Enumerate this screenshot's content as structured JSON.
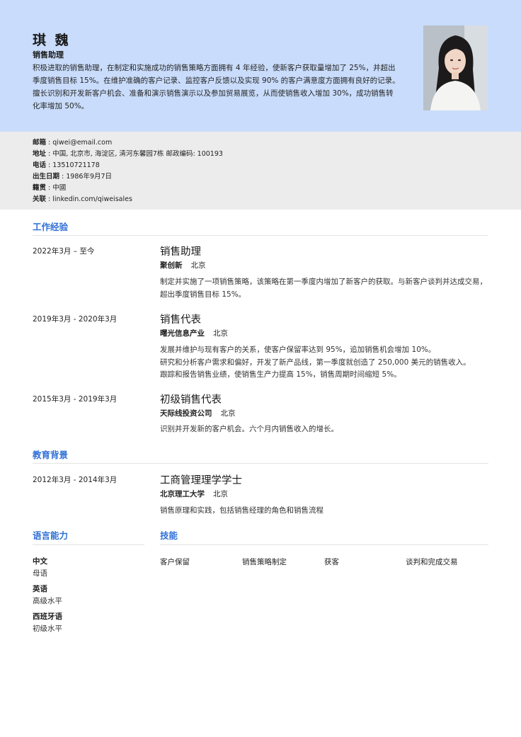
{
  "header": {
    "name": "琪 魏",
    "title": "销售助理",
    "summary": "积极进取的销售助理，在制定和实施成功的销售策略方面拥有 4 年经验，使新客户获取量增加了 25%，并超出季度销售目标 15%。在维护准确的客户记录、监控客户反馈以及实现 90% 的客户满意度方面拥有良好的记录。擅长识别和开发新客户机会、准备和演示销售演示以及参加贸易展览，从而使销售收入增加 30%，成功销售转化率增加 50%。"
  },
  "contact": [
    {
      "label": "邮箱",
      "value": "qiwei@email.com"
    },
    {
      "label": "地址",
      "value": "中国, 北京市, 海淀区, 清河东馨园7栋 邮政编码: 100193"
    },
    {
      "label": "电话",
      "value": "13510721178"
    },
    {
      "label": "出生日期",
      "value": "1986年9月7日"
    },
    {
      "label": "籍贯",
      "value": "中國"
    },
    {
      "label": "关联",
      "value": "linkedin.com/qiweisales"
    }
  ],
  "sections": {
    "experience": "工作经验",
    "education": "教育背景",
    "languages": "语言能力",
    "skills": "技能"
  },
  "experience": [
    {
      "date": "2022年3月 – 至今",
      "role": "销售助理",
      "org": "聚创新",
      "location": "北京",
      "desc": [
        "制定并实施了一项销售策略，该策略在第一季度内增加了新客户的获取。与新客户谈判并达成交易，超出季度销售目标 15%。"
      ]
    },
    {
      "date": "2019年3月 - 2020年3月",
      "role": "销售代表",
      "org": "曙光信息产业",
      "location": "北京",
      "desc": [
        "发展并维护与现有客户的关系，使客户保留率达到 95%，追加销售机会增加 10%。",
        "研究和分析客户需求和偏好，开发了新产品线，第一季度就创造了 250,000 美元的销售收入。",
        "跟踪和报告销售业绩，使销售生产力提高 15%，销售周期时间缩短 5%。"
      ]
    },
    {
      "date": "2015年3月 - 2019年3月",
      "role": "初级销售代表",
      "org": "天际线投资公司",
      "location": "北京",
      "desc": [
        "识别并开发新的客户机会。六个月内销售收入的增长。"
      ]
    }
  ],
  "education": [
    {
      "date": "2012年3月 - 2014年3月",
      "role": "工商管理理学学士",
      "org": "北京理工大学",
      "location": "北京",
      "desc": [
        "销售原理和实践，包括销售经理的角色和销售流程"
      ]
    }
  ],
  "languages": [
    {
      "name": "中文",
      "level": "母语"
    },
    {
      "name": "英语",
      "level": "高级水平"
    },
    {
      "name": "西班牙语",
      "level": "初级水平"
    }
  ],
  "skills": [
    "客户保留",
    "销售策略制定",
    "获客",
    "谈判和完成交易"
  ]
}
